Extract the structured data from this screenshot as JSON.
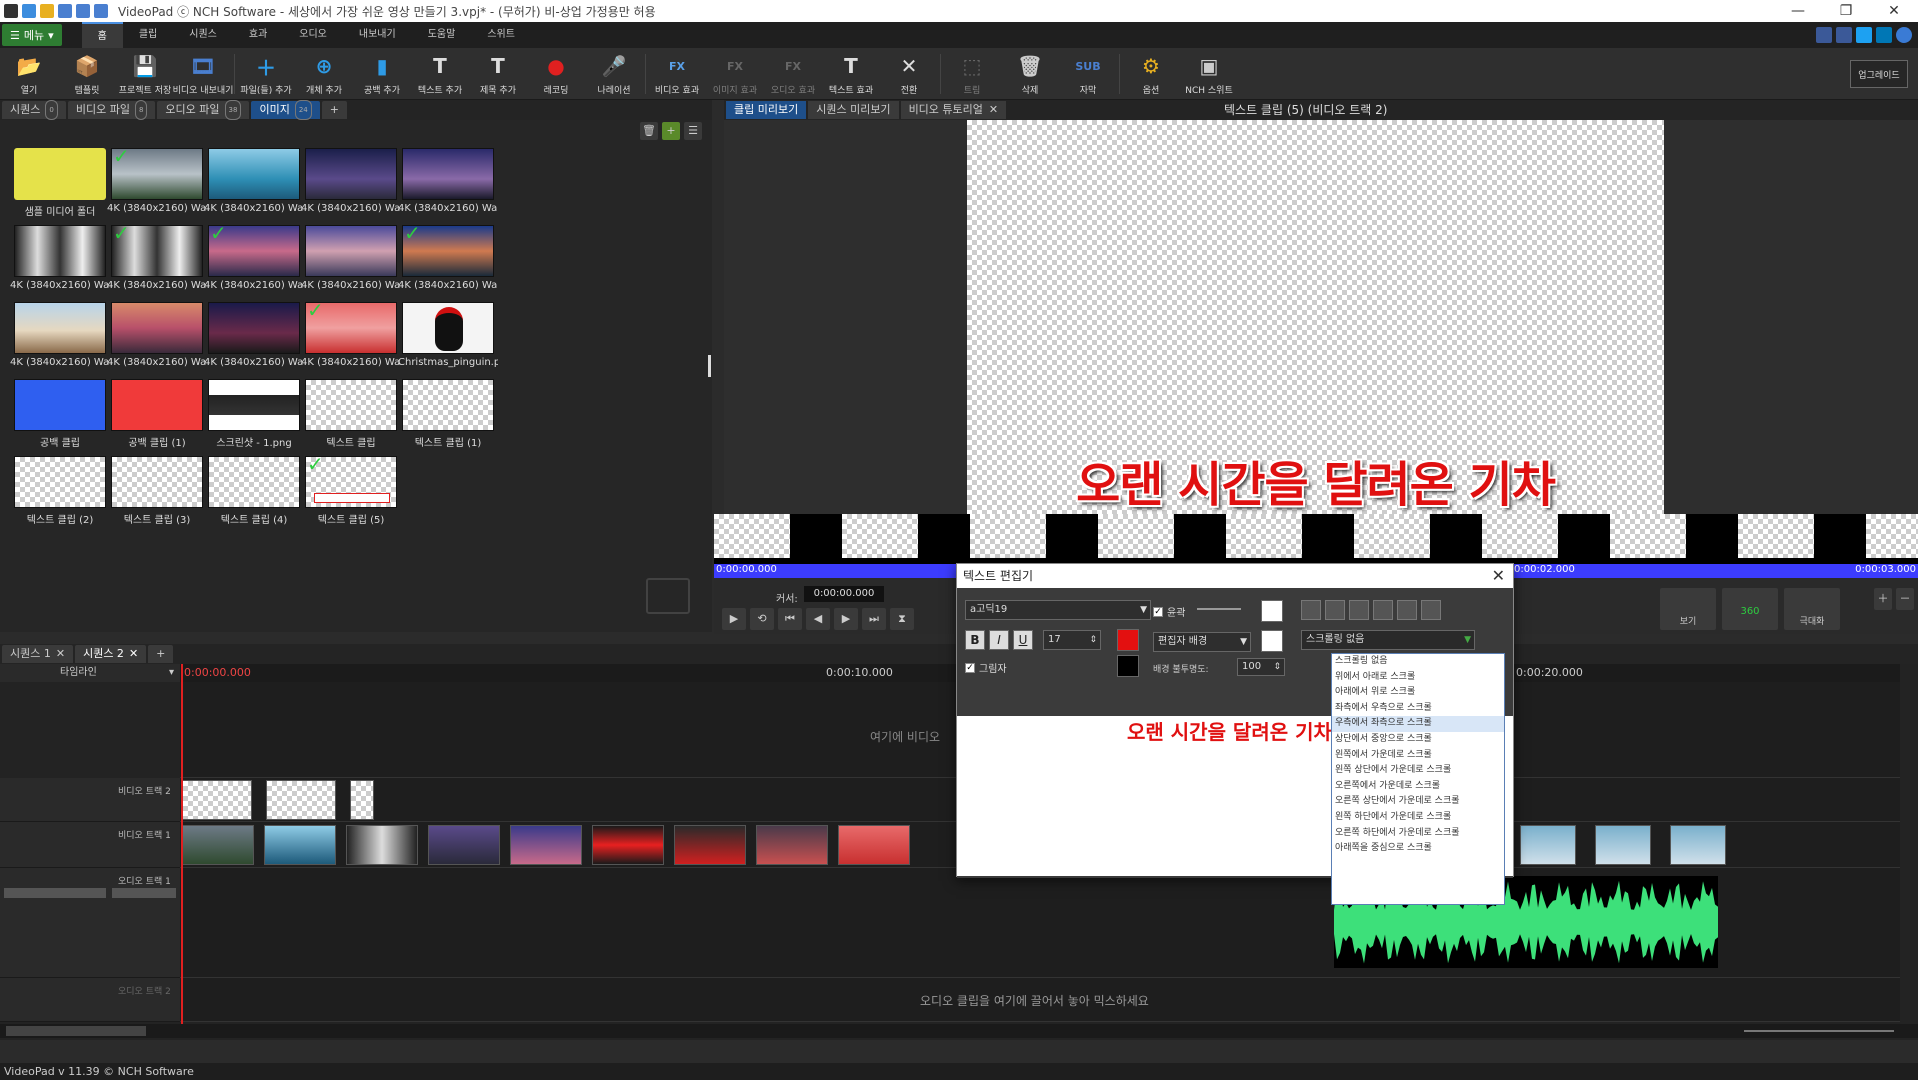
{
  "titlebar": {
    "title": "VideoPad ⓒ NCH Software - 세상에서 가장 쉬운 영상 만들기 3.vpj* - (무허가) 비-상업 가정용만 허용",
    "min": "—",
    "max": "❐",
    "close": "✕"
  },
  "menubar": {
    "menu_label": "메뉴",
    "tabs": [
      "홈",
      "클립",
      "시퀀스",
      "효과",
      "오디오",
      "내보내기",
      "도움말",
      "스위트"
    ],
    "active_tab": "홈"
  },
  "toolbar": {
    "buttons": [
      {
        "label": "열기",
        "icon": "folder-open-icon",
        "glyph": "📂",
        "dim": false
      },
      {
        "label": "템플릿",
        "icon": "template-icon",
        "glyph": "📦",
        "dim": false
      },
      {
        "label": "프로젝트 저장",
        "icon": "save-icon",
        "glyph": "💾",
        "dim": false
      },
      {
        "label": "비디오 내보내기",
        "icon": "export-video-icon",
        "glyph": "🎞",
        "dim": false
      },
      {
        "label": "파일(들) 추가",
        "icon": "add-file-icon",
        "glyph": "＋",
        "dim": false
      },
      {
        "label": "개체 추가",
        "icon": "add-object-icon",
        "glyph": "⊕",
        "dim": false
      },
      {
        "label": "공백 추가",
        "icon": "add-blank-icon",
        "glyph": "▮",
        "dim": false
      },
      {
        "label": "텍스트 추가",
        "icon": "add-text-icon",
        "glyph": "T",
        "dim": false
      },
      {
        "label": "제목 추가",
        "icon": "add-title-icon",
        "glyph": "T",
        "dim": false
      },
      {
        "label": "레코딩",
        "icon": "record-icon",
        "glyph": "●",
        "dim": false
      },
      {
        "label": "나레이션",
        "icon": "narration-icon",
        "glyph": "🎤",
        "dim": false
      },
      {
        "label": "비디오 효과",
        "icon": "video-fx-icon",
        "glyph": "FX",
        "dim": false
      },
      {
        "label": "이미지 효과",
        "icon": "image-fx-icon",
        "glyph": "FX",
        "dim": true
      },
      {
        "label": "오디오 효과",
        "icon": "audio-fx-icon",
        "glyph": "FX",
        "dim": true
      },
      {
        "label": "텍스트 효과",
        "icon": "text-fx-icon",
        "glyph": "T",
        "dim": false
      },
      {
        "label": "전환",
        "icon": "transition-icon",
        "glyph": "✕",
        "dim": false
      },
      {
        "label": "트림",
        "icon": "trim-icon",
        "glyph": "⬚",
        "dim": true
      },
      {
        "label": "삭제",
        "icon": "delete-icon",
        "glyph": "🗑",
        "dim": false
      },
      {
        "label": "자막",
        "icon": "subtitle-icon",
        "glyph": "SUB",
        "dim": false
      },
      {
        "label": "옵션",
        "icon": "options-icon",
        "glyph": "⚙",
        "dim": false
      },
      {
        "label": "NCH 스위트",
        "icon": "nch-suite-icon",
        "glyph": "▣",
        "dim": false
      }
    ],
    "upgrade_label": "업그레이드"
  },
  "media": {
    "tabs": [
      {
        "label": "시퀀스",
        "count": "0"
      },
      {
        "label": "비디오 파일",
        "count": "8"
      },
      {
        "label": "오디오 파일",
        "count": "38"
      },
      {
        "label": "이미지",
        "count": "24"
      }
    ],
    "active_tab": "이미지",
    "add_tab": "+",
    "items": [
      {
        "caption": "샘플 미디어 폴더",
        "kind": "folder",
        "check": false
      },
      {
        "caption": "4K (3840x2160) Wallp...",
        "kind": "storm",
        "check": true
      },
      {
        "caption": "4K (3840x2160) Wallp...",
        "kind": "sea",
        "check": false
      },
      {
        "caption": "4K (3840x2160) Wallp...",
        "kind": "galaxy",
        "check": false
      },
      {
        "caption": "4K (3840x2160) Wallp...",
        "kind": "galaxy2",
        "check": false
      },
      {
        "caption": "4K (3840x2160) Wallp...",
        "kind": "bw",
        "check": false
      },
      {
        "caption": "4K (3840x2160) Wallp...",
        "kind": "bw",
        "check": true
      },
      {
        "caption": "4K (3840x2160) Wallp...",
        "kind": "sunset",
        "check": true
      },
      {
        "caption": "4K (3840x2160) Wallp...",
        "kind": "sunset2",
        "check": false
      },
      {
        "caption": "4K (3840x2160) Wallp...",
        "kind": "coast",
        "check": true
      },
      {
        "caption": "4K (3840x2160) Wallp...",
        "kind": "desert",
        "check": false
      },
      {
        "caption": "4K (3840x2160) Wallp...",
        "kind": "lake",
        "check": false
      },
      {
        "caption": "4K (3840x2160) Wallp...",
        "kind": "road",
        "check": false
      },
      {
        "caption": "4K (3840x2160) Wallp...",
        "kind": "flowers",
        "check": true
      },
      {
        "caption": "Christmas_pinguin.png",
        "kind": "penguin",
        "check": false
      },
      {
        "caption": "공백 클립",
        "kind": "blue",
        "check": false
      },
      {
        "caption": "공백 클립 (1)",
        "kind": "red",
        "check": false
      },
      {
        "caption": "스크린샷 - 1.png",
        "kind": "screenshot",
        "check": false
      },
      {
        "caption": "텍스트 클립",
        "kind": "text",
        "check": false
      },
      {
        "caption": "텍스트 클립 (1)",
        "kind": "text",
        "check": false
      },
      {
        "caption": "텍스트 클립 (2)",
        "kind": "text",
        "check": false
      },
      {
        "caption": "텍스트 클립 (3)",
        "kind": "text",
        "check": false
      },
      {
        "caption": "텍스트 클립 (4)",
        "kind": "text",
        "check": false
      },
      {
        "caption": "텍스트 클립 (5)",
        "kind": "text5",
        "check": true
      }
    ]
  },
  "preview": {
    "tabs": [
      "클립 미리보기",
      "시퀀스 미리보기",
      "비디오 튜토리얼"
    ],
    "active_tab": "클립 미리보기",
    "title": "텍스트 클립 (5) (비디오 트랙 2)",
    "canvas_text": "오랜 시간을 달려온 기차",
    "start_time": "0:00:00.000",
    "end_time": "0:00:03.000",
    "mid_time": "0:00:02.000",
    "cursor_label": "커서:",
    "cursor_value": "0:00:00.000",
    "view_label": "보기",
    "btn_360": "360",
    "maximize_label": "극대화"
  },
  "sequence": {
    "tabs": [
      "시퀀스 1",
      "시퀀스 2"
    ],
    "add_tab": "+",
    "timeline_label": "타임라인",
    "ruler": [
      "0:00:00.000",
      "0:00:10.000",
      "0:00:20.000"
    ],
    "tracks": [
      "비디오 트랙 2",
      "비디오 트랙 1",
      "오디오 트랙 1",
      "오디오 트랙 2"
    ],
    "drop_video_hint": "여기에 비디오",
    "drop_audio_hint": "오디오 클립을 여기에 끌어서 놓아 믹스하세요"
  },
  "dialog": {
    "title": "텍스트 편집기",
    "font": "a고딕19",
    "size": "17",
    "bold": "B",
    "italic": "I",
    "underline": "U",
    "outline_label": "윤곽",
    "shadow_label": "그림자",
    "bg_select": "편집자 배경",
    "opacity_label": "배경 불투명도:",
    "opacity_value": "100",
    "scroll_select": "스크롤링 없음",
    "text": "오랜 시간을 달려온 기차",
    "text_color": "#e31010",
    "scroll_options": [
      "스크롤링 없음",
      "위에서 아래로 스크롤",
      "아래에서 위로 스크롤",
      "좌측에서 우측으로 스크롤",
      "우측에서 좌측으로 스크롤",
      "상단에서 중앙으로 스크롤",
      "왼쪽에서 가운데로 스크롤",
      "왼쪽 상단에서 가운데로 스크롤",
      "오른쪽에서 가운데로 스크롤",
      "오른쪽 상단에서 가운데로 스크롤",
      "왼쪽 하단에서 가운데로 스크롤",
      "오른쪽 하단에서 가운데로 스크롤",
      "아래쪽을 중심으로 스크롤"
    ],
    "scroll_highlight_index": 4
  },
  "status": {
    "text": "VideoPad v 11.39 © NCH Software"
  }
}
